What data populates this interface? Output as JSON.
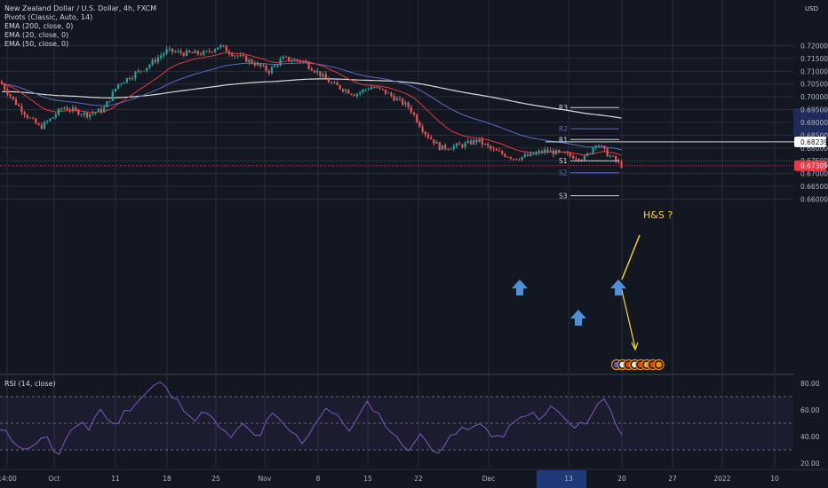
{
  "legend": {
    "title": "New Zealand Dollar / U.S. Dollar, 4h, FXCM",
    "pivots": "Pivots (Classic, Auto, 14)",
    "ema200": "EMA (200, close, 0)",
    "ema20": "EMA (20, close, 0)",
    "ema50": "EMA (50, close, 0)",
    "rsi": "RSI (14, close)"
  },
  "currency": "USD",
  "annotation": "H&S ?",
  "colors": {
    "background": "#131722",
    "grid": "#2a2e39",
    "text": "#b2b5be",
    "up": "#26a69a",
    "down": "#ef5350",
    "ema200": "#d9d9d9",
    "ema20": "#e53935",
    "ema50": "#5c6bc0",
    "rsi": "#7e57c2",
    "annotation": "#fdd835",
    "arrows": "#4d90d8",
    "price_tag": "#f23645"
  },
  "price_axis": {
    "ticks": [
      "0.72000",
      "0.71500",
      "0.71000",
      "0.70500",
      "0.70000",
      "0.69500",
      "0.69000",
      "0.68500",
      "0.68000",
      "0.67500",
      "0.67000",
      "0.66500",
      "0.66000"
    ],
    "highlight_band": "0.6950 – 0.6850",
    "horizontal_level_label": "0.68239",
    "last_price_label": "0.67309"
  },
  "time_axis": [
    "14:00",
    "Oct",
    "11",
    "18",
    "25",
    "Nov",
    "8",
    "15",
    "22",
    "Dec",
    "13",
    "20",
    "27",
    "2022",
    "10"
  ],
  "time_axis_highlight": "13",
  "rsi_axis": [
    "80.00",
    "60.00",
    "40.00",
    "20.00"
  ],
  "chart_data": [
    {
      "type": "candlestick",
      "ylim": [
        0.6565,
        0.7235
      ],
      "series": [
        {
          "name": "EMA (200, close, 0)"
        },
        {
          "name": "EMA (20, close, 0)"
        },
        {
          "name": "EMA (50, close, 0)"
        }
      ],
      "price_path": [
        {
          "date": "Sep 27",
          "close": 0.706
        },
        {
          "date": "Sep 29",
          "close": 0.699
        },
        {
          "date": "Oct 1",
          "close": 0.692
        },
        {
          "date": "Oct 4",
          "close": 0.688
        },
        {
          "date": "Oct 6",
          "close": 0.692
        },
        {
          "date": "Oct 8",
          "close": 0.696
        },
        {
          "date": "Oct 11",
          "close": 0.693
        },
        {
          "date": "Oct 13",
          "close": 0.695
        },
        {
          "date": "Oct 15",
          "close": 0.705
        },
        {
          "date": "Oct 18",
          "close": 0.712
        },
        {
          "date": "Oct 20",
          "close": 0.718
        },
        {
          "date": "Oct 22",
          "close": 0.717
        },
        {
          "date": "Oct 25",
          "close": 0.717
        },
        {
          "date": "Oct 27",
          "close": 0.72
        },
        {
          "date": "Oct 29",
          "close": 0.717
        },
        {
          "date": "Nov 1",
          "close": 0.713
        },
        {
          "date": "Nov 3",
          "close": 0.71
        },
        {
          "date": "Nov 5",
          "close": 0.715
        },
        {
          "date": "Nov 8",
          "close": 0.714
        },
        {
          "date": "Nov 10",
          "close": 0.71
        },
        {
          "date": "Nov 12",
          "close": 0.705
        },
        {
          "date": "Nov 15",
          "close": 0.701
        },
        {
          "date": "Nov 17",
          "close": 0.704
        },
        {
          "date": "Nov 19",
          "close": 0.702
        },
        {
          "date": "Nov 22",
          "close": 0.696
        },
        {
          "date": "Nov 24",
          "close": 0.686
        },
        {
          "date": "Nov 26",
          "close": 0.68
        },
        {
          "date": "Nov 29",
          "close": 0.681
        },
        {
          "date": "Dec 1",
          "close": 0.683
        },
        {
          "date": "Dec 3",
          "close": 0.679
        },
        {
          "date": "Dec 6",
          "close": 0.676
        },
        {
          "date": "Dec 8",
          "close": 0.677
        },
        {
          "date": "Dec 10",
          "close": 0.679
        },
        {
          "date": "Dec 13",
          "close": 0.677
        },
        {
          "date": "Dec 15",
          "close": 0.676
        },
        {
          "date": "Dec 16",
          "close": 0.6823
        },
        {
          "date": "Dec 17",
          "close": 0.678
        },
        {
          "date": "Dec 18",
          "close": 0.6731
        }
      ],
      "pivots": [
        {
          "label": "R3",
          "value": 0.6958
        },
        {
          "label": "R2",
          "value": 0.6875
        },
        {
          "label": "R1",
          "value": 0.6833
        },
        {
          "label": "S1",
          "value": 0.675
        },
        {
          "label": "S2",
          "value": 0.6703
        },
        {
          "label": "S3",
          "value": 0.6613
        }
      ],
      "horizontal_level": 0.68239,
      "last_price": 0.67309
    },
    {
      "type": "line",
      "title": "RSI (14, close)",
      "ylim": [
        15,
        85
      ],
      "levels": [
        70,
        50,
        30
      ],
      "values": [
        45,
        42,
        38,
        35,
        32,
        30,
        36,
        40,
        38,
        30,
        26,
        35,
        42,
        48,
        52,
        45,
        55,
        60,
        55,
        48,
        52,
        58,
        62,
        66,
        70,
        74,
        78,
        80,
        76,
        70,
        66,
        62,
        58,
        52,
        56,
        60,
        52,
        46,
        42,
        40,
        44,
        48,
        45,
        40,
        42,
        50,
        56,
        52,
        48,
        44,
        40,
        36,
        42,
        48,
        56,
        62,
        58,
        54,
        50,
        46,
        50,
        58,
        64,
        62,
        56,
        50,
        44,
        38,
        34,
        32,
        36,
        40,
        36,
        32,
        30,
        34,
        38,
        42,
        46,
        44,
        48,
        52,
        46,
        40,
        38,
        42,
        46,
        50,
        54,
        58,
        56,
        52,
        56,
        62,
        60,
        54,
        50,
        46,
        48,
        52,
        58,
        64,
        68,
        62,
        50,
        42
      ]
    }
  ]
}
